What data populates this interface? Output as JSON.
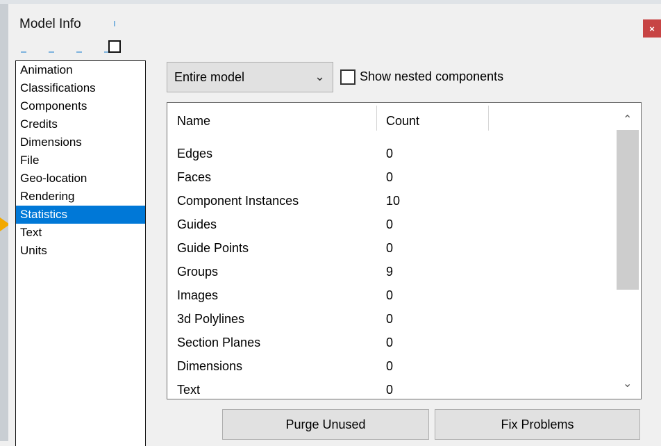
{
  "window": {
    "title": "Model Info",
    "close_label": "×"
  },
  "sidebar": {
    "items": [
      {
        "label": "Animation",
        "selected": false
      },
      {
        "label": "Classifications",
        "selected": false
      },
      {
        "label": "Components",
        "selected": false
      },
      {
        "label": "Credits",
        "selected": false
      },
      {
        "label": "Dimensions",
        "selected": false
      },
      {
        "label": "File",
        "selected": false
      },
      {
        "label": "Geo-location",
        "selected": false
      },
      {
        "label": "Rendering",
        "selected": false
      },
      {
        "label": "Statistics",
        "selected": true
      },
      {
        "label": "Text",
        "selected": false
      },
      {
        "label": "Units",
        "selected": false
      }
    ]
  },
  "scope": {
    "selected": "Entire model",
    "chevron_icon": "chevron-down-icon"
  },
  "nested": {
    "label": "Show nested components",
    "checked": false
  },
  "table": {
    "columns": [
      "Name",
      "Count"
    ],
    "rows": [
      {
        "name": "Edges",
        "count": "0"
      },
      {
        "name": "Faces",
        "count": "0"
      },
      {
        "name": "Component Instances",
        "count": "10"
      },
      {
        "name": "Guides",
        "count": "0"
      },
      {
        "name": "Guide Points",
        "count": "0"
      },
      {
        "name": "Groups",
        "count": "9"
      },
      {
        "name": "Images",
        "count": "0"
      },
      {
        "name": "3d Polylines",
        "count": "0"
      },
      {
        "name": "Section Planes",
        "count": "0"
      },
      {
        "name": "Dimensions",
        "count": "0"
      },
      {
        "name": "Text",
        "count": "0"
      }
    ]
  },
  "buttons": {
    "purge": "Purge Unused",
    "fix": "Fix Problems"
  },
  "colors": {
    "selection": "#0078d7",
    "close_bg": "#c74444",
    "pointer": "#f2a900"
  }
}
